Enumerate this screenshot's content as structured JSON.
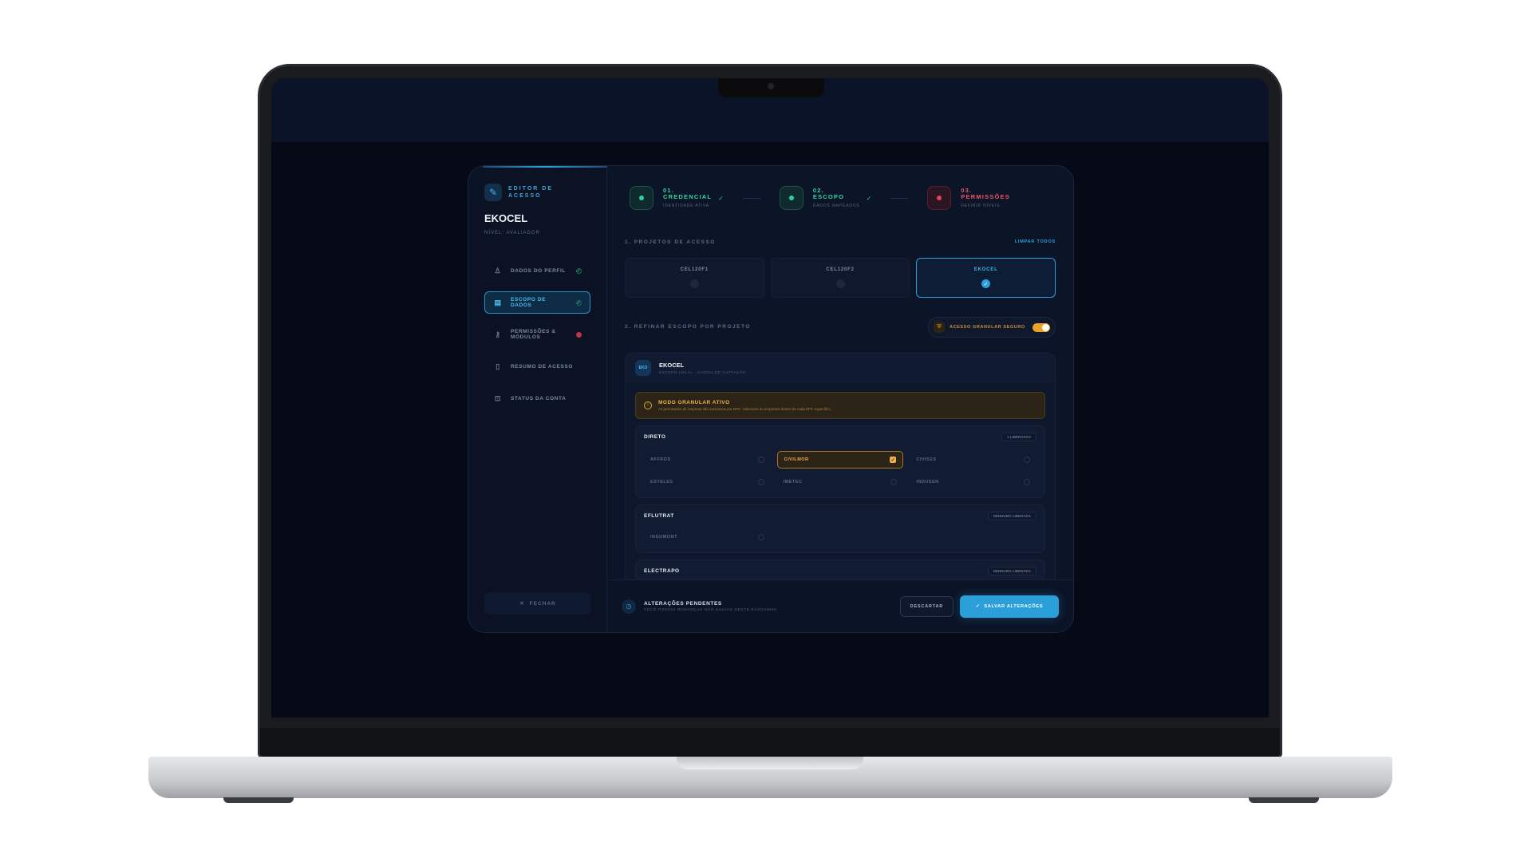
{
  "sidebar": {
    "kicker": "EDITOR DE ACESSO",
    "title": "EKOCEL",
    "subtitle": "NÍVEL: AVALIADOR",
    "items": [
      {
        "label": "DADOS DO PERFIL",
        "status": "ok"
      },
      {
        "label": "ESCOPO DE DADOS",
        "status": "ok"
      },
      {
        "label": "PERMISSÕES & MÓDULOS",
        "status": "error"
      },
      {
        "label": "RESUMO DE ACESSO",
        "status": "none"
      },
      {
        "label": "STATUS DA CONTA",
        "status": "none"
      }
    ],
    "close_label": "FECHAR"
  },
  "steps": [
    {
      "num": "01.",
      "name": "CREDENCIAL",
      "desc": "IDENTIDADE ATIVA",
      "state": "done"
    },
    {
      "num": "02.",
      "name": "ESCOPO",
      "desc": "DADOS MAPEADOS",
      "state": "done"
    },
    {
      "num": "03.",
      "name": "PERMISSÕES",
      "desc": "DEFINIR NÍVEIS",
      "state": "error"
    }
  ],
  "projects_section": {
    "label": "1. PROJETOS DE ACESSO",
    "clear_link": "LIMPAR TODOS",
    "projects": [
      {
        "name": "CEL120F1",
        "selected": false
      },
      {
        "name": "CEL120F2",
        "selected": false
      },
      {
        "name": "EKOCEL",
        "selected": true
      }
    ]
  },
  "refine_section": {
    "label": "2. REFINAR ESCOPO POR PROJETO",
    "toggle_label": "ACESSO GRANULAR SEGURO",
    "toggle_on": true
  },
  "panel": {
    "avatar": "EKO",
    "title": "EKOCEL",
    "subtitle": "ESCOPO LOCAL · CADEIA DE CAPTAÇÃO",
    "alert_title": "MODO GRANULAR ATIVO",
    "alert_desc": "As permissões de empresa são exclusivas por EPC. Selecione as empresas dentro de cada EPC específico.",
    "groups": [
      {
        "title": "DIRETO",
        "badge": "1 LIBERADAS",
        "options": [
          {
            "label": "AFFROS",
            "checked": false
          },
          {
            "label": "CIVILMOR",
            "checked": true
          },
          {
            "label": "CIVISES",
            "checked": false
          },
          {
            "label": "ESTELEC",
            "checked": false
          },
          {
            "label": "IMETEC",
            "checked": false
          },
          {
            "label": "INDUSEN",
            "checked": false
          }
        ]
      },
      {
        "title": "EFLUTRAT",
        "badge": "NENHUMA LIBERADA",
        "options": [
          {
            "label": "INGUMONT",
            "checked": false
          }
        ]
      },
      {
        "title": "ELECTRAPO",
        "badge": "NENHUMA LIBERADA",
        "options": []
      }
    ]
  },
  "footer": {
    "title": "ALTERAÇÕES PENDENTES",
    "subtitle": "VOCÊ POSSUI MUDANÇAS NÃO SALVAS NESTE RASCUNHO",
    "discard_label": "DESCARTAR",
    "save_label": "SALVAR ALTERAÇÕES"
  },
  "colors": {
    "accent": "#2a9fd9",
    "success": "#27d69a",
    "danger": "#e2445c",
    "warning": "#f0b14a",
    "background": "#050a16"
  }
}
